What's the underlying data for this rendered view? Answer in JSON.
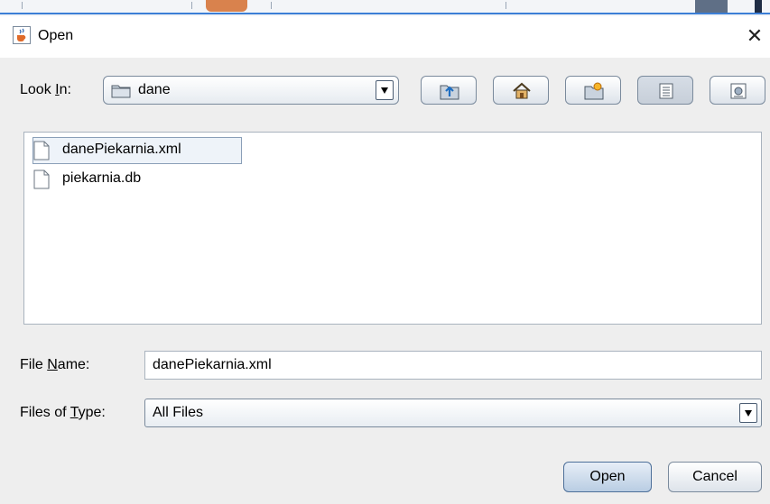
{
  "dialog": {
    "title": "Open"
  },
  "look_in": {
    "label_pre": "Look ",
    "label_mnemonic": "I",
    "label_post": "n:",
    "value": "dane"
  },
  "toolbar": {
    "buttons": [
      {
        "name": "up-one-level",
        "icon": "folder-up-icon"
      },
      {
        "name": "home",
        "icon": "home-icon"
      },
      {
        "name": "create-new-folder",
        "icon": "new-folder-icon"
      },
      {
        "name": "list-view",
        "icon": "list-view-icon",
        "selected": true
      },
      {
        "name": "details-view",
        "icon": "details-view-icon"
      }
    ]
  },
  "files": [
    {
      "name": "danePiekarnia.xml",
      "selected": true
    },
    {
      "name": "piekarnia.db",
      "selected": false
    }
  ],
  "file_name": {
    "label_pre": "File ",
    "label_mnemonic": "N",
    "label_post": "ame:",
    "value": "danePiekarnia.xml"
  },
  "files_of_type": {
    "label_pre": "Files of ",
    "label_mnemonic": "T",
    "label_post": "ype:",
    "value": "All Files"
  },
  "buttons": {
    "open": "Open",
    "cancel": "Cancel"
  },
  "colors": {
    "dialog_bg": "#eeeeee",
    "selection_border": "#8a9fb8",
    "primary_button": "#b9cde3"
  }
}
